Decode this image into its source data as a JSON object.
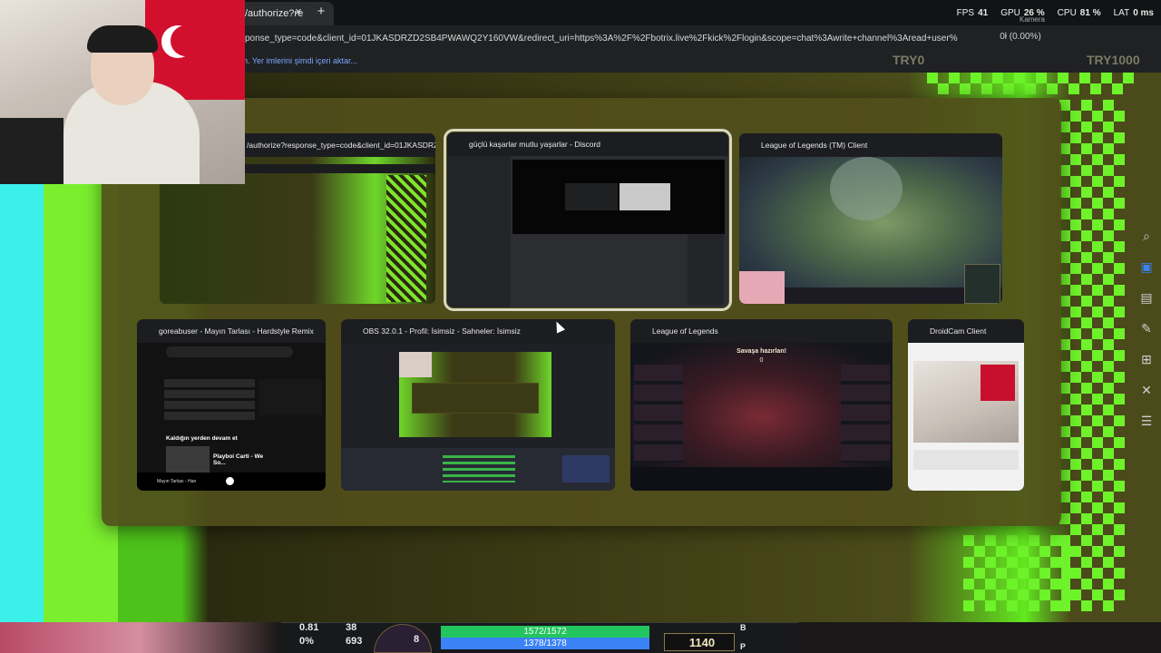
{
  "browser": {
    "tab_title": "/authorize?re",
    "tab_close": "×",
    "tab_new": "+",
    "url": "ponse_type=code&client_id=01JKASDRZD2SB4PWAWQ2Y160VW&redirect_uri=https%3A%2F%2Fbotrix.live%2Fkick%2Flogin&scope=chat%3Awrite+channel%3Aread+user%",
    "bookmarks_prefix": "n.",
    "bookmarks_link": "Yer imlerini şimdi içeri aktar..."
  },
  "perf": {
    "fps_label": "FPS",
    "fps_value": "41",
    "gpu_label": "GPU",
    "gpu_value": "26 %",
    "cpu_label": "CPU",
    "cpu_value": "81 %",
    "lat_label": "LAT",
    "lat_value": "0 ms",
    "sub_label": "Kamera"
  },
  "overlay": {
    "ratio": "0ł (0.00%)",
    "try0": "TRY0",
    "try1000": "TRY1000"
  },
  "windows": [
    {
      "title": "/authorize?response_type=code&client_id=01JKASDRZ...",
      "icon": "browser-icon",
      "color": "#ff9800"
    },
    {
      "title": "güçlü kaşarlar mutlu yaşarlar - Discord",
      "icon": "discord-icon",
      "color": "#5865f2"
    },
    {
      "title": "League of Legends (TM) Client",
      "icon": "league-icon",
      "color": "#c8a24a"
    },
    {
      "title": "goreabuser - Mayın Tarlası - Hardstyle Remix",
      "icon": "spotify-icon",
      "color": "#1db954"
    },
    {
      "title": "OBS 32.0.1 - Profil: İsimsiz - Sahneler: İsimsiz",
      "icon": "obs-icon",
      "color": "#e0e0e0"
    },
    {
      "title": "League of Legends",
      "icon": "league-icon",
      "color": "#c8a24a"
    },
    {
      "title": "DroidCam Client",
      "icon": "droidcam-icon",
      "color": "#6cc04a"
    }
  ],
  "previews": {
    "spotify_greeting": "Kaldığın yerden devam et",
    "spotify_track": "Playboi Carti - We So...",
    "spotify_now": "Mayın Tarlası - Han",
    "lol_ready": "Savaşa hazırlan!",
    "lol_count": "0"
  },
  "hud": {
    "stat1": "0.81",
    "stat2": "38",
    "stat3": "0%",
    "stat4": "693",
    "level": "8",
    "hp": "1572/1572",
    "mana": "1378/1378",
    "gold": "1140",
    "key_b": "B",
    "key_p": "P"
  },
  "rail": [
    "search-icon",
    "photo-icon",
    "save-icon",
    "edit-icon",
    "gamepad-icon",
    "tools-icon",
    "settings-icon"
  ],
  "colors": {
    "selected_outline": "#d9d6c2",
    "panel": "#504e1a",
    "hp_bar": "#22c55e",
    "mana_bar": "#3b82f6"
  }
}
